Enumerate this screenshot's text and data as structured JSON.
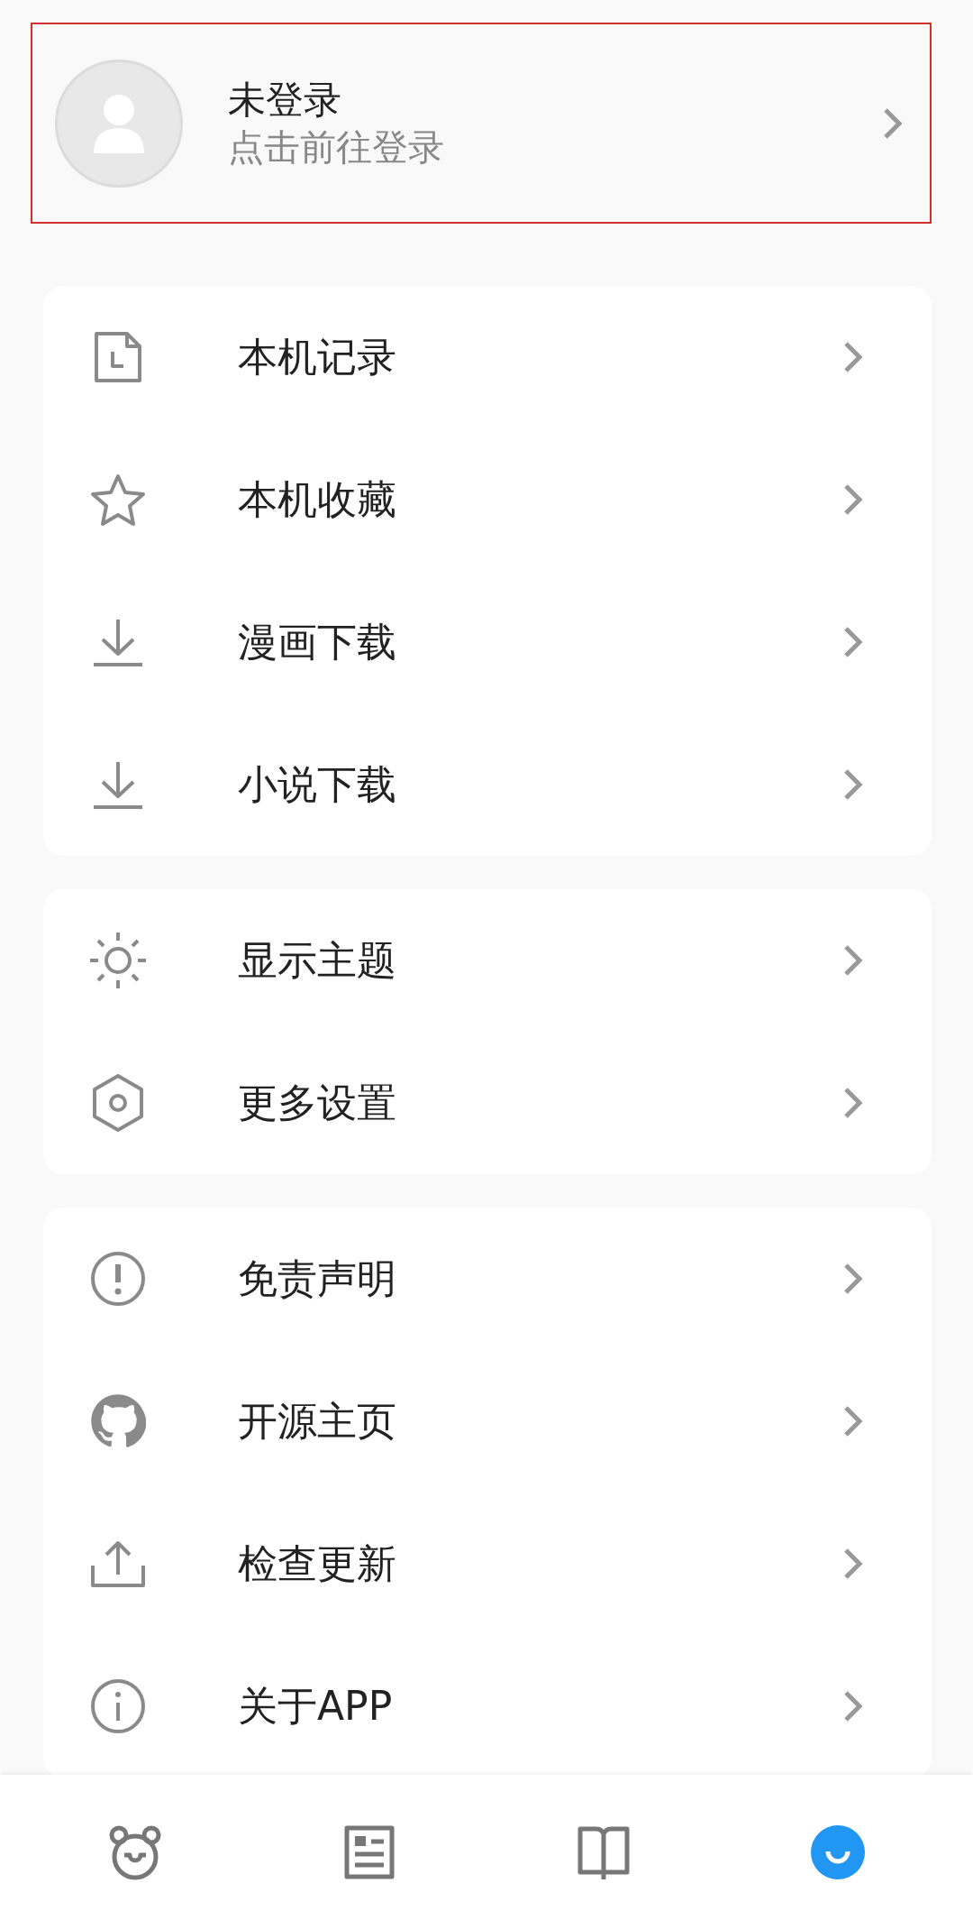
{
  "profile": {
    "title": "未登录",
    "subtitle": "点击前往登录"
  },
  "groups": [
    {
      "items": [
        {
          "kind": "history",
          "label": "本机记录"
        },
        {
          "kind": "star",
          "label": "本机收藏"
        },
        {
          "kind": "download",
          "label": "漫画下载"
        },
        {
          "kind": "download",
          "label": "小说下载"
        }
      ]
    },
    {
      "items": [
        {
          "kind": "theme",
          "label": "显示主题"
        },
        {
          "kind": "settings",
          "label": "更多设置"
        }
      ]
    },
    {
      "items": [
        {
          "kind": "alert",
          "label": "免责声明"
        },
        {
          "kind": "github",
          "label": "开源主页"
        },
        {
          "kind": "upload",
          "label": "检查更新"
        },
        {
          "kind": "info",
          "label": "关于APP"
        }
      ]
    }
  ],
  "nav": [
    {
      "kind": "bear",
      "selected": false
    },
    {
      "kind": "news",
      "selected": false
    },
    {
      "kind": "book",
      "selected": false
    },
    {
      "kind": "me",
      "selected": true
    }
  ]
}
